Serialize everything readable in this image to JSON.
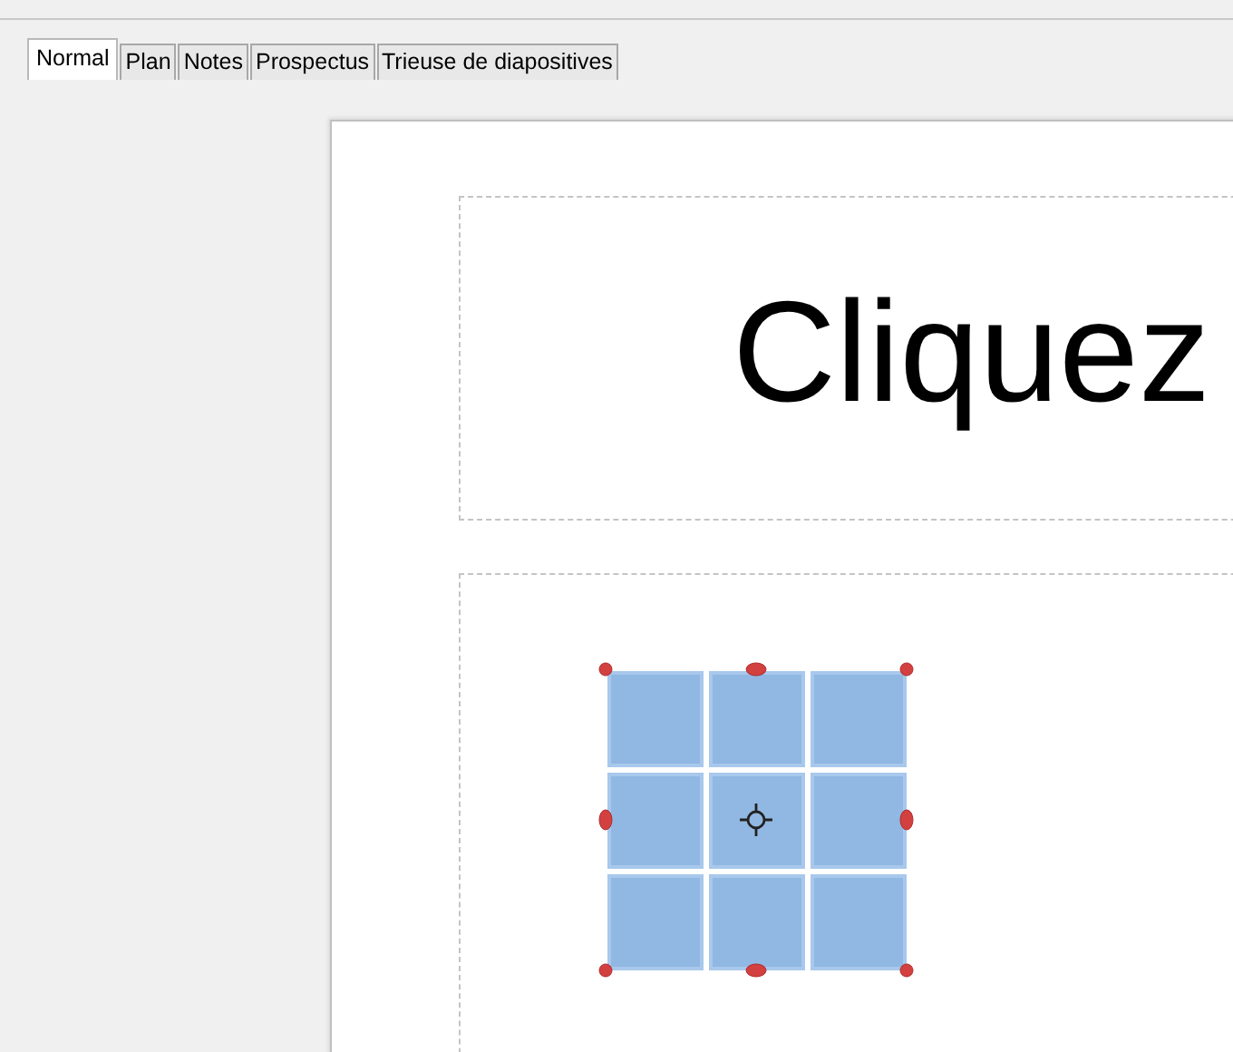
{
  "tabs": [
    {
      "label": "Normal",
      "selected": true
    },
    {
      "label": "Plan",
      "selected": false
    },
    {
      "label": "Notes",
      "selected": false
    },
    {
      "label": "Prospectus",
      "selected": false
    },
    {
      "label": "Trieuse de diapositives",
      "selected": false
    }
  ],
  "slide": {
    "title": "Cliquez",
    "graphic": {
      "selected": true
    }
  }
}
